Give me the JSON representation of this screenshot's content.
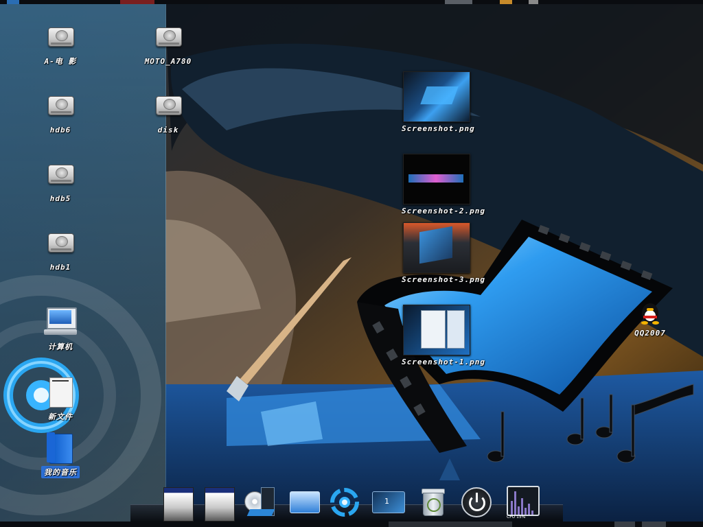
{
  "desktop": {
    "icons": [
      {
        "label": "A-电 影",
        "type": "drive"
      },
      {
        "label": "MOTO_A780",
        "type": "drive"
      },
      {
        "label": "hdb6",
        "type": "drive"
      },
      {
        "label": "disk",
        "type": "drive"
      },
      {
        "label": "hdb5",
        "type": "drive"
      },
      {
        "label": "hdb1",
        "type": "drive"
      },
      {
        "label": "计算机",
        "type": "computer"
      },
      {
        "label": "新文件",
        "type": "file"
      },
      {
        "label": "我的音乐",
        "type": "folder",
        "selected": true
      },
      {
        "label": "Screenshot.png",
        "type": "image"
      },
      {
        "label": "Screenshot-2.png",
        "type": "image"
      },
      {
        "label": "Screenshot-3.png",
        "type": "image"
      },
      {
        "label": "Screenshot-1.png",
        "type": "image"
      },
      {
        "label": "QQ2007",
        "type": "application"
      }
    ]
  },
  "dock": {
    "items": [
      {
        "name": "window-thumbnail-1",
        "icon": "window-icon"
      },
      {
        "name": "window-thumbnail-2",
        "icon": "window-icon"
      },
      {
        "name": "media-player",
        "icon": "film-disc-icon"
      },
      {
        "name": "show-desktop",
        "icon": "desktop-icon"
      },
      {
        "name": "launcher",
        "icon": "swirl-logo-icon"
      },
      {
        "name": "workspace-switcher",
        "icon": "workspace-icon",
        "label": "1"
      },
      {
        "name": "trash",
        "icon": "trash-icon"
      },
      {
        "name": "shutdown",
        "icon": "power-icon"
      },
      {
        "name": "cpu-monitor",
        "icon": "cpu-graph-icon",
        "label": "CPU 15%"
      }
    ]
  },
  "colors": {
    "accent": "#2b6fd6",
    "panel": "#3f86b8",
    "wallpaper-blue": "#1f8fe6"
  }
}
